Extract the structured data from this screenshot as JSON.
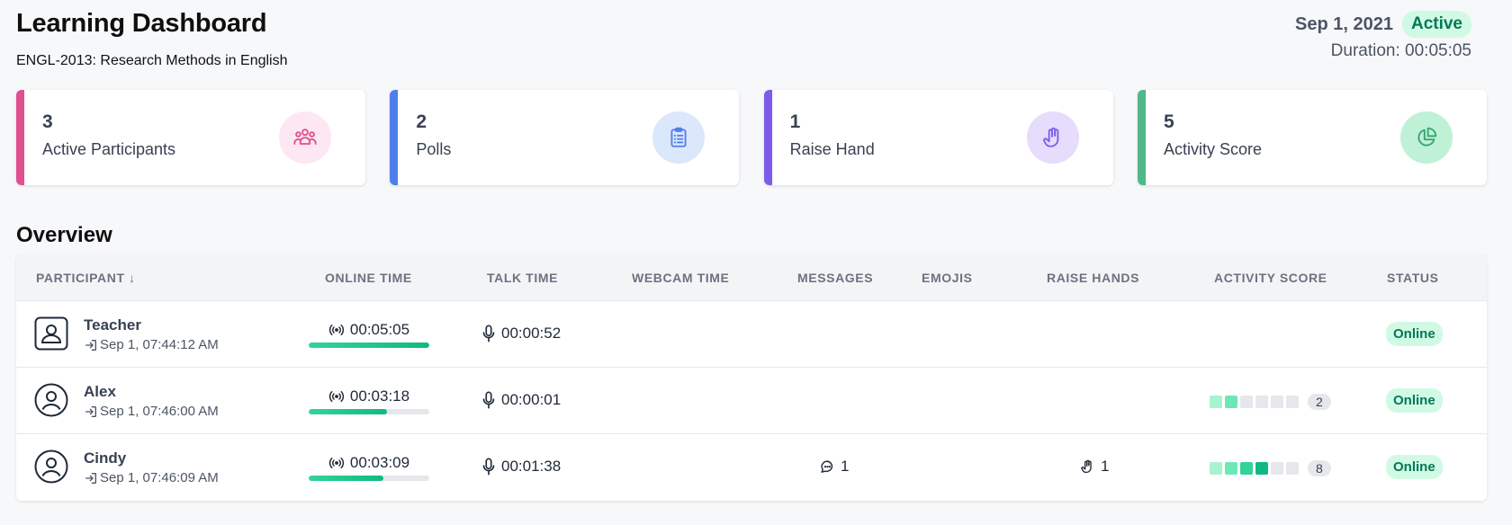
{
  "header": {
    "title": "Learning Dashboard",
    "course": "ENGL-2013: Research Methods in English",
    "date": "Sep 1, 2021",
    "status_badge": "Active",
    "duration": "Duration: 00:05:05"
  },
  "cards": [
    {
      "value": "3",
      "label": "Active Participants",
      "color": "#e0508f",
      "bg": "#fce7f3",
      "icon": "users-icon"
    },
    {
      "value": "2",
      "label": "Polls",
      "color": "#4f7fea",
      "bg": "#dbe7fb",
      "icon": "clipboard-icon"
    },
    {
      "value": "1",
      "label": "Raise Hand",
      "color": "#7c5ce9",
      "bg": "#e6dcfc",
      "icon": "hand-icon"
    },
    {
      "value": "5",
      "label": "Activity Score",
      "color": "#4fb889",
      "bg": "#bff1d7",
      "icon": "pie-chart-icon"
    }
  ],
  "overview": {
    "title": "Overview",
    "columns": {
      "participant": "Participant ↓",
      "online_time": "Online Time",
      "talk_time": "Talk Time",
      "webcam_time": "Webcam Time",
      "messages": "Messages",
      "emojis": "Emojis",
      "raise_hands": "Raise Hands",
      "activity_score": "Activity Score",
      "status": "Status"
    },
    "rows": [
      {
        "name": "Teacher",
        "joined": "Sep 1, 07:44:12 AM",
        "online_time": "00:05:05",
        "online_fraction": 1.0,
        "talk_time": "00:00:52",
        "messages": "",
        "raise_hands": "",
        "score": "",
        "score_levels": [],
        "status": "Online",
        "avatar": "presenter-avatar-icon"
      },
      {
        "name": "Alex",
        "joined": "Sep 1, 07:46:00 AM",
        "online_time": "00:03:18",
        "online_fraction": 0.65,
        "talk_time": "00:00:01",
        "messages": "",
        "raise_hands": "",
        "score": "2",
        "score_levels": [
          1,
          2,
          0,
          0,
          0,
          0
        ],
        "status": "Online",
        "avatar": "user-avatar-icon"
      },
      {
        "name": "Cindy",
        "joined": "Sep 1, 07:46:09 AM",
        "online_time": "00:03:09",
        "online_fraction": 0.62,
        "talk_time": "00:01:38",
        "messages": "1",
        "raise_hands": "1",
        "score": "8",
        "score_levels": [
          1,
          2,
          3,
          4,
          0,
          0
        ],
        "status": "Online",
        "avatar": "user-avatar-icon"
      }
    ]
  }
}
